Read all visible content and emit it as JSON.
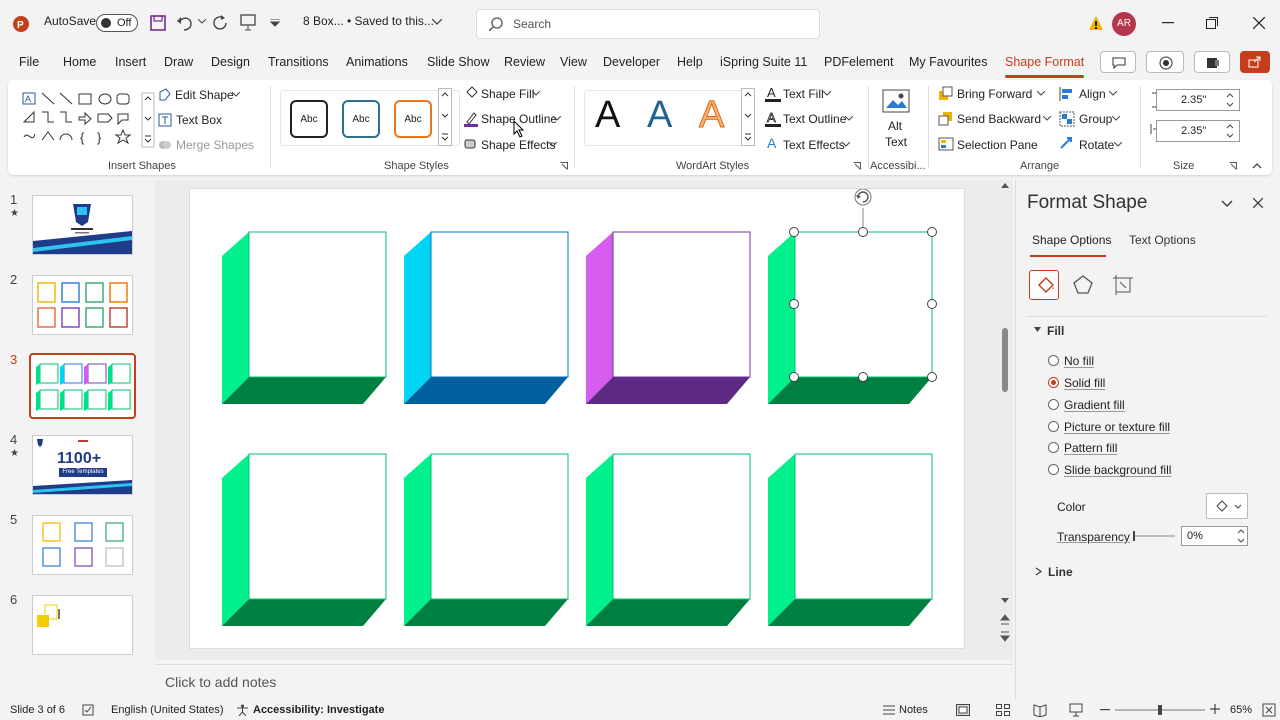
{
  "titlebar": {
    "autosave_label": "AutoSave",
    "autosave_state": "Off",
    "doc_title": "8 Box... • Saved to this...",
    "search_placeholder": "Search",
    "user_initials": "AR",
    "app_icon": "powerpoint-icon"
  },
  "menu": {
    "items": [
      "File",
      "Home",
      "Insert",
      "Draw",
      "Design",
      "Transitions",
      "Animations",
      "Slide Show",
      "Review",
      "View",
      "Developer",
      "Help",
      "iSpring Suite 11",
      "PDFelement",
      "My Favourites",
      "Shape Format"
    ],
    "active": "Shape Format"
  },
  "ribbon": {
    "insert_shapes": {
      "edit_shape": "Edit Shape",
      "text_box": "Text Box",
      "merge_shapes": "Merge Shapes",
      "label": "Insert Shapes"
    },
    "shape_styles": {
      "sample": "Abc",
      "fill": "Shape Fill",
      "outline": "Shape Outline",
      "effects": "Shape Effects",
      "label": "Shape Styles"
    },
    "wordart": {
      "sample": "A",
      "text_fill": "Text Fill",
      "text_outline": "Text Outline",
      "text_effects": "Text Effects",
      "label": "WordArt Styles"
    },
    "accessibility": {
      "alt_text_1": "Alt",
      "alt_text_2": "Text",
      "label": "Accessibi..."
    },
    "arrange": {
      "bring_forward": "Bring Forward",
      "send_backward": "Send Backward",
      "selection_pane": "Selection Pane",
      "align": "Align",
      "group": "Group",
      "rotate": "Rotate",
      "label": "Arrange"
    },
    "size": {
      "height": "2.35\"",
      "width": "2.35\"",
      "label": "Size"
    }
  },
  "thumbnails": {
    "numbers": [
      "1",
      "2",
      "3",
      "4",
      "5",
      "6"
    ],
    "selected": 3,
    "slide4_text": "1100+",
    "slide4_sub": "Free Templates"
  },
  "notes_placeholder": "Click to add notes",
  "pane": {
    "title": "Format Shape",
    "tab_shape": "Shape Options",
    "tab_text": "Text Options",
    "fill_section": "Fill",
    "fill_options": [
      "No fill",
      "Solid fill",
      "Gradient fill",
      "Picture or texture fill",
      "Pattern fill",
      "Slide background fill"
    ],
    "fill_selected": "Solid fill",
    "color_label": "Color",
    "transparency_label": "Transparency",
    "transparency_value": "0%",
    "line_section": "Line"
  },
  "status": {
    "slide_info": "Slide 3 of 6",
    "language": "English (United States)",
    "accessibility": "Accessibility: Investigate",
    "notes": "Notes",
    "zoom": "65%"
  },
  "colors": {
    "accent": "#c43e1c",
    "green_side": "#00f08c",
    "green_bottom": "#008040",
    "cyan_side": "#00d4f5",
    "blue_bottom": "#00609e",
    "magenta_side": "#d65cf0",
    "purple_bottom": "#5c2a82"
  }
}
